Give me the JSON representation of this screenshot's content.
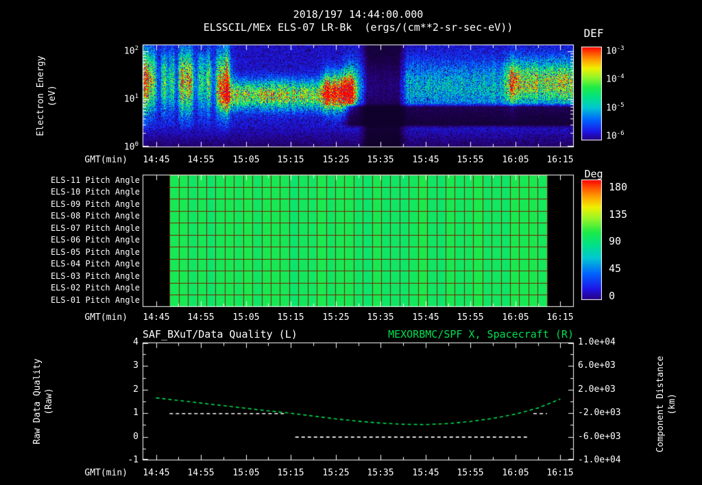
{
  "header": {
    "datetime": "2018/197 14:44:00.000",
    "title": "ELSSCIL/MEx ELS-07 LR-Bk  (ergs/(cm**2-sr-sec-eV))"
  },
  "colors": {
    "background": "#000000",
    "text": "#ffffff",
    "series_green": "#00df50",
    "quality_white": "#ffffff",
    "grid_red": "#7a1e00",
    "panel_border": "#ffffff"
  },
  "x_ticks": [
    "14:45",
    "14:55",
    "15:05",
    "15:15",
    "15:25",
    "15:35",
    "15:45",
    "15:55",
    "16:05",
    "16:15"
  ],
  "spectrogram_panel": {
    "colorbar_title": "DEF",
    "colorbar_ticks": [
      {
        "base": "10",
        "exp": "-3"
      },
      {
        "base": "10",
        "exp": "-4"
      },
      {
        "base": "10",
        "exp": "-5"
      },
      {
        "base": "10",
        "exp": "-6"
      }
    ],
    "y_ticks": [
      {
        "base": "10",
        "exp": "2"
      },
      {
        "base": "10",
        "exp": "1"
      },
      {
        "base": "10",
        "exp": "0"
      }
    ],
    "y_axis_label_line1": "Electron Energy",
    "y_axis_label_line2": "(eV)",
    "x_axis_label": "GMT(min)"
  },
  "pitch_panel": {
    "row_labels": [
      "ELS-11 Pitch Angle",
      "ELS-10 Pitch Angle",
      "ELS-09 Pitch Angle",
      "ELS-08 Pitch Angle",
      "ELS-07 Pitch Angle",
      "ELS-06 Pitch Angle",
      "ELS-05 Pitch Angle",
      "ELS-04 Pitch Angle",
      "ELS-03 Pitch Angle",
      "ELS-02 Pitch Angle",
      "ELS-01 Pitch Angle"
    ],
    "colorbar_title": "Deg",
    "colorbar_ticks": [
      "180",
      "135",
      "90",
      "45",
      "0"
    ],
    "x_axis_label": "GMT(min)"
  },
  "bottom_panel": {
    "title_left": "SAF_BXuT/Data Quality (L)",
    "title_right": "MEXORBMC/SPF X, Spacecraft (R)",
    "left_ticks": [
      "4",
      "3",
      "2",
      "1",
      "0",
      "-1"
    ],
    "right_ticks": [
      "1.0e+04",
      "6.0e+03",
      "2.0e+03",
      "-2.0e+03",
      "-6.0e+03",
      "-1.0e+04"
    ],
    "y_axis_label_line1": "Raw Data Quality",
    "y_axis_label_line2": "(Raw)",
    "right_axis_label_line1": "Component Distance",
    "right_axis_label_line2": "(km)",
    "x_axis_label": "GMT(min)"
  },
  "chart_data": [
    {
      "type": "heatmap",
      "name": "electron-energy-spectrogram",
      "title": "ELSSCIL/MEx ELS-07 LR-Bk",
      "units": "ergs/(cm**2-sr-sec-eV)",
      "x_range": [
        "14:42",
        "16:18"
      ],
      "x_ticks": [
        "14:45",
        "14:55",
        "15:05",
        "15:15",
        "15:25",
        "15:35",
        "15:45",
        "15:55",
        "16:05",
        "16:15"
      ],
      "y_scale": "log",
      "y_range_eV": [
        1,
        140
      ],
      "colorbar": {
        "title": "DEF",
        "scale": "log",
        "range": [
          1e-06,
          0.001
        ]
      },
      "features": [
        {
          "time": [
            "14:42",
            "15:01"
          ],
          "energy_eV": [
            5,
            110
          ],
          "level": "intense"
        },
        {
          "time": [
            "15:00",
            "15:28"
          ],
          "energy_eV": [
            6,
            26
          ],
          "level": "strong"
        },
        {
          "time": [
            "15:23",
            "15:28"
          ],
          "energy_eV": [
            6,
            40
          ],
          "level": "strong"
        },
        {
          "time": [
            "15:28",
            "16:04"
          ],
          "energy_eV": [
            5,
            70
          ],
          "level": "weak"
        },
        {
          "time": [
            "15:32",
            "15:39"
          ],
          "energy_eV": [
            1,
            140
          ],
          "level": "minimal"
        },
        {
          "time": [
            "15:28",
            "16:18"
          ],
          "energy_eV": [
            3,
            7
          ],
          "level": "minimal"
        },
        {
          "time": [
            "16:04",
            "16:18"
          ],
          "energy_eV": [
            7,
            70
          ],
          "level": "strong"
        }
      ]
    },
    {
      "type": "heatmap",
      "name": "pitch-angle-panels",
      "rows": [
        "ELS-11",
        "ELS-10",
        "ELS-09",
        "ELS-08",
        "ELS-07",
        "ELS-06",
        "ELS-05",
        "ELS-04",
        "ELS-03",
        "ELS-02",
        "ELS-01"
      ],
      "value_deg": 95,
      "data_start": "14:48",
      "data_end": "16:12",
      "columns": 41,
      "colorbar": {
        "title": "Deg",
        "range": [
          0,
          180
        ],
        "ticks": [
          180,
          135,
          90,
          45,
          0
        ]
      }
    },
    {
      "type": "line",
      "name": "quality-and-distance",
      "x_range": [
        "14:42",
        "16:18"
      ],
      "left_axis": {
        "label": "Raw Data Quality (Raw)",
        "range": [
          -1,
          4
        ]
      },
      "right_axis": {
        "label": "Component Distance (km)",
        "range": [
          -10000,
          10000
        ]
      },
      "series": [
        {
          "name": "SAF_BXuT/Data Quality (L)",
          "axis": "left",
          "color": "#ffffff",
          "style": "dashed",
          "segments": [
            {
              "x": [
                "14:48",
                "15:14"
              ],
              "y": 1
            },
            {
              "x": [
                "15:16",
                "16:08"
              ],
              "y": 0
            },
            {
              "x": [
                "16:09",
                "16:12"
              ],
              "y": 1
            }
          ]
        },
        {
          "name": "MEXORBMC/SPF X, Spacecraft (R)",
          "axis": "right",
          "color": "#00df50",
          "style": "dashed",
          "x": [
            "14:45",
            "14:50",
            "14:55",
            "15:00",
            "15:05",
            "15:10",
            "15:15",
            "15:20",
            "15:25",
            "15:30",
            "15:35",
            "15:40",
            "15:45",
            "15:50",
            "15:55",
            "16:00",
            "16:05",
            "16:10",
            "16:15"
          ],
          "y_km": [
            600,
            160,
            -280,
            -720,
            -1160,
            -1600,
            -2000,
            -2480,
            -2960,
            -3360,
            -3680,
            -3880,
            -3920,
            -3760,
            -3400,
            -2880,
            -2160,
            -1120,
            400
          ]
        }
      ]
    }
  ]
}
